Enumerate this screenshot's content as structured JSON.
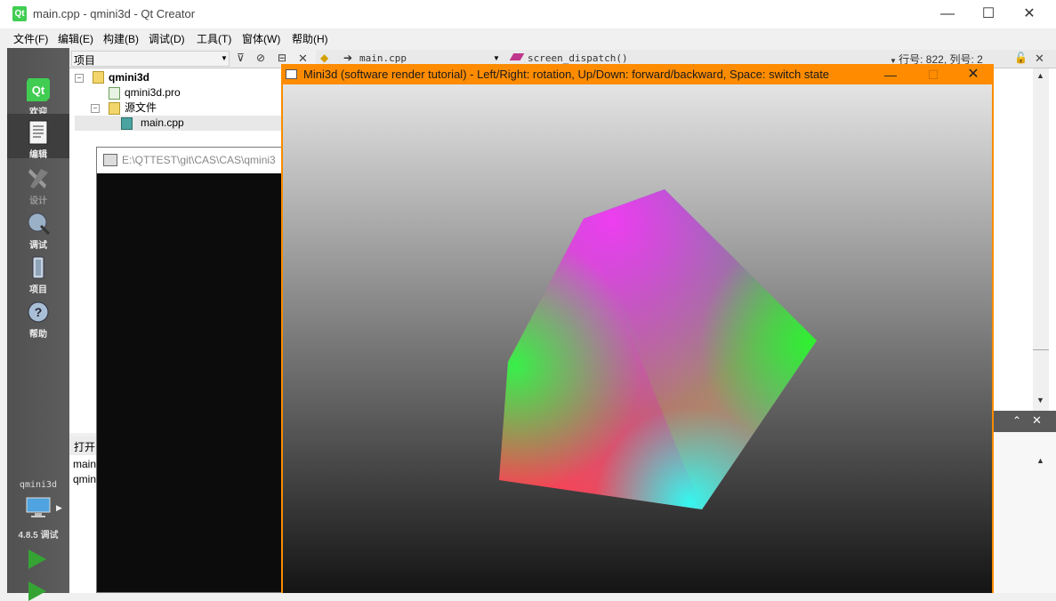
{
  "window": {
    "title": "main.cpp - qmini3d - Qt Creator",
    "app_icon_text": "Qt",
    "minimize": "—",
    "maximize": "☐",
    "close": "✕"
  },
  "menu": [
    "文件(F)",
    "编辑(E)",
    "构建(B)",
    "调试(D)",
    "工具(T)",
    "窗体(W)",
    "帮助(H)"
  ],
  "modes": [
    {
      "label": "欢迎",
      "icon": "qt-logo-icon"
    },
    {
      "label": "编辑",
      "icon": "edit-document-icon"
    },
    {
      "label": "设计",
      "icon": "design-pen-icon"
    },
    {
      "label": "调试",
      "icon": "debug-bug-icon"
    },
    {
      "label": "项目",
      "icon": "project-wrench-icon"
    },
    {
      "label": "帮助",
      "icon": "help-icon"
    }
  ],
  "kit": {
    "project": "qmini3d",
    "version": "4.8.5 调试"
  },
  "projects_panel": {
    "combo_label": "项目",
    "tree": [
      {
        "label": "qmini3d",
        "expander": "−",
        "bold": true
      },
      {
        "label": "qmini3d.pro"
      },
      {
        "label": "源文件",
        "expander": "−"
      },
      {
        "label": "main.cpp"
      }
    ]
  },
  "open_documents": {
    "title": "打开",
    "items": [
      "main",
      "qmin"
    ]
  },
  "editor_bar": {
    "file": "main.cpp",
    "symbol": "screen_dispatch()",
    "position": "行号: 822, 列号: 2"
  },
  "console_window": {
    "title": "E:\\QTTEST\\git\\CAS\\CAS\\qmini3"
  },
  "mini3d_window": {
    "title": "Mini3d (software render tutorial) - Left/Right: rotation, Up/Down: forward/backward, Space: switch state",
    "minimize": "—",
    "maximize": "☐",
    "close": "✕"
  },
  "colors": {
    "mini3d_title_bar": "#ff8c00",
    "rail": "#595959",
    "console_bg": "#0c0c0c",
    "qt_green": "#41cd52"
  }
}
